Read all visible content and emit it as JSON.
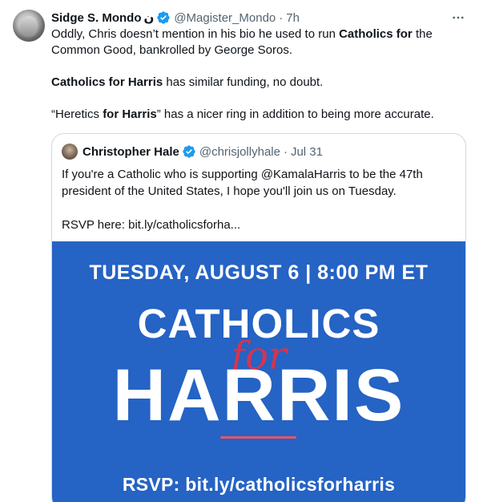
{
  "tweet": {
    "author_name": "Sidge S. Mondo",
    "author_suffix": "ن",
    "handle": "@Magister_Mondo",
    "separator": "·",
    "time": "7h",
    "more_icon": "more-horizontal-icon",
    "paragraphs": {
      "p1_pre": "Oddly, Chris doesn’t mention in his bio he used to run ",
      "p1_bold": "Catholics for",
      "p1_post_line1": " the",
      "p1_line2": "Common Good, bankrolled by George Soros.",
      "p2_bold": "Catholics for Harris",
      "p2_post": " has similar funding, no doubt.",
      "p3_pre": "“Heretics ",
      "p3_bold": "for Harris",
      "p3_post": "” has a nicer ring in addition to being more accurate."
    }
  },
  "quote": {
    "author_name": "Christopher Hale",
    "handle": "@chrisjollyhale",
    "separator": "·",
    "time": "Jul 31",
    "line1": "If you're a Catholic who is supporting @KamalaHarris to be the 47th",
    "line2": "president of the United States, I hope you'll join us on Tuesday.",
    "line3": "RSVP here: bit.ly/catholicsforha...",
    "media": {
      "date_line": "TUESDAY, AUGUST 6 | 8:00 PM ET",
      "catholics": "CATHOLICS",
      "for": "for",
      "harris": "HARRIS",
      "rsvp": "RSVP: bit.ly/catholicsforharris",
      "bg_color": "#2563c4",
      "accent_color": "#d9334c"
    }
  },
  "colors": {
    "verified_blue": "#1d9bf0",
    "secondary_text": "#536471",
    "border": "#cfd9de"
  }
}
